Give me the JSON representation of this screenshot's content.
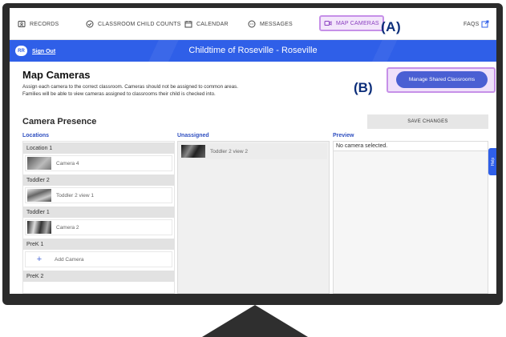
{
  "nav": {
    "records": "RECORDS",
    "child_counts": "CLASSROOM CHILD COUNTS",
    "calendar": "CALENDAR",
    "messages": "MESSAGES",
    "map_cameras": "MAP CAMERAS",
    "faqs": "FAQS"
  },
  "callouts": {
    "a": "(A)",
    "b": "(B)"
  },
  "banner": {
    "avatar_initials": "RR",
    "sign_out": "Sign Out",
    "title": "Childtime of Roseville - Roseville"
  },
  "page": {
    "title": "Map Cameras",
    "desc_line1": "Assign each camera to the correct classroom. Cameras should not be assigned to common areas.",
    "desc_line2": "Families will be able to view cameras assigned to classrooms their child is checked into.",
    "manage_shared": "Manage Shared Classrooms",
    "section_title": "Camera Presence",
    "save_changes": "SAVE CHANGES"
  },
  "columns": {
    "locations": "Locations",
    "unassigned": "Unassigned",
    "preview": "Preview"
  },
  "locations": [
    {
      "name": "Location 1",
      "camera": "Camera 4"
    },
    {
      "name": "Toddler 2",
      "camera": "Toddler 2 view 1"
    },
    {
      "name": "Toddler 1",
      "camera": "Camera 2"
    },
    {
      "name": "PreK 1",
      "add_label": "Add Camera"
    },
    {
      "name": "PreK 2"
    }
  ],
  "unassigned": [
    {
      "camera": "Toddler 2 view 2"
    }
  ],
  "preview": {
    "empty_text": "No camera selected."
  },
  "help": "Help",
  "colors": {
    "banner_blue": "#2f5fe8",
    "highlight_purple": "#c690e8",
    "button_blue": "#4a5fd3",
    "callout_navy": "#0c2e7a"
  }
}
